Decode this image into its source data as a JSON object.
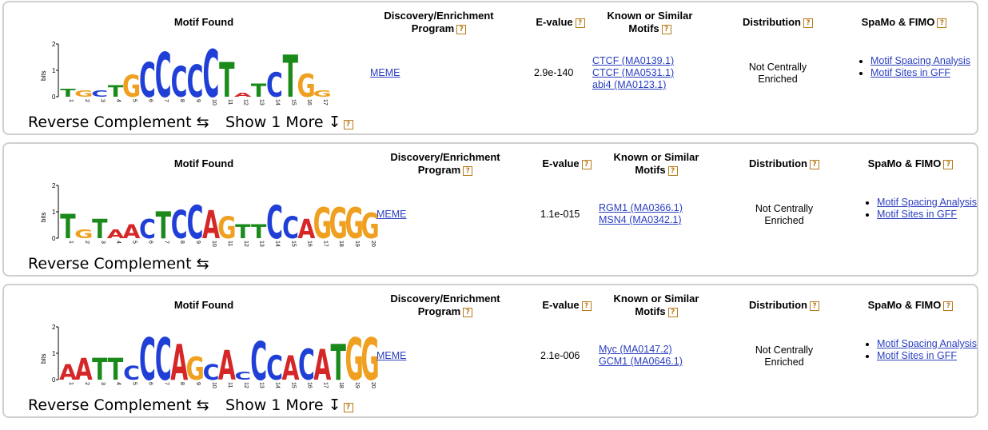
{
  "headers": {
    "motif_found": "Motif Found",
    "discovery_line1": "Discovery/Enrichment",
    "discovery_line2": "Program",
    "evalue": "E-value",
    "known_line1": "Known or Similar",
    "known_line2": "Motifs",
    "distribution": "Distribution",
    "spamo": "SpaMo & FIMO",
    "help": "?"
  },
  "logo_labels": {
    "y_axis": "bits",
    "y_ticks": [
      "2",
      "1",
      "0"
    ]
  },
  "actions": {
    "reverse_complement": "Reverse Complement ⇆",
    "show_more": "Show 1 More ↧"
  },
  "motifs": [
    {
      "program": "MEME",
      "evalue": "2.9e-140",
      "known": [
        "CTCF (MA0139.1)",
        "CTCF (MA0531.1)",
        "abi4 (MA0123.1)"
      ],
      "distribution_line1": "Not Centrally",
      "distribution_line2": "Enriched",
      "spamo_links": [
        "Motif Spacing Analysis",
        "Motif Sites in GFF"
      ],
      "has_show_more": true,
      "logo_letters": [
        "T",
        "G",
        "C",
        "T",
        "G",
        "C",
        "C",
        "C",
        "C",
        "C",
        "T",
        "A",
        "T",
        "C",
        "T",
        "G",
        "G"
      ],
      "logo_heights": [
        0.3,
        0.25,
        0.25,
        0.45,
        0.85,
        1.35,
        1.75,
        1.2,
        1.25,
        1.85,
        1.35,
        0.15,
        0.5,
        0.95,
        1.65,
        0.9,
        0.25
      ]
    },
    {
      "program": "MEME",
      "evalue": "1.1e-015",
      "known": [
        "RGM1 (MA0366.1)",
        "MSN4 (MA0342.1)"
      ],
      "distribution_line1": "Not Centrally",
      "distribution_line2": "Enriched",
      "spamo_links": [
        "Motif Spacing Analysis",
        "Motif Sites in GFF"
      ],
      "has_show_more": false,
      "logo_letters": [
        "T",
        "G",
        "T",
        "A",
        "A",
        "C",
        "T",
        "C",
        "C",
        "A",
        "G",
        "T",
        "T",
        "C",
        "C",
        "A",
        "G",
        "G",
        "G",
        "G"
      ],
      "logo_heights": [
        0.95,
        0.35,
        0.75,
        0.35,
        0.55,
        0.75,
        1.05,
        1.1,
        1.3,
        1.1,
        0.85,
        0.55,
        0.55,
        1.3,
        0.85,
        0.75,
        1.2,
        1.2,
        1.2,
        1.0
      ]
    },
    {
      "program": "MEME",
      "evalue": "2.1e-006",
      "known": [
        "Myc (MA0147.2)",
        "GCM1 (MA0646.1)"
      ],
      "distribution_line1": "Not Centrally",
      "distribution_line2": "Enriched",
      "spamo_links": [
        "Motif Spacing Analysis",
        "Motif Sites in GFF"
      ],
      "has_show_more": true,
      "logo_letters": [
        "A",
        "A",
        "T",
        "T",
        "C",
        "C",
        "C",
        "A",
        "G",
        "C",
        "A",
        "C",
        "C",
        "C",
        "A",
        "C",
        "A",
        "T",
        "G",
        "G"
      ],
      "logo_heights": [
        0.6,
        0.85,
        0.85,
        0.85,
        0.55,
        1.65,
        1.65,
        1.4,
        0.9,
        0.6,
        1.15,
        0.3,
        1.5,
        0.95,
        0.95,
        1.2,
        1.2,
        1.4,
        1.65,
        1.65
      ]
    }
  ],
  "colors": {
    "A": "#d62728",
    "C": "#1f3fd6",
    "G": "#f0a020",
    "T": "#1a8a1a",
    "help": "#b87a1a",
    "link": "#2a3fc0"
  }
}
